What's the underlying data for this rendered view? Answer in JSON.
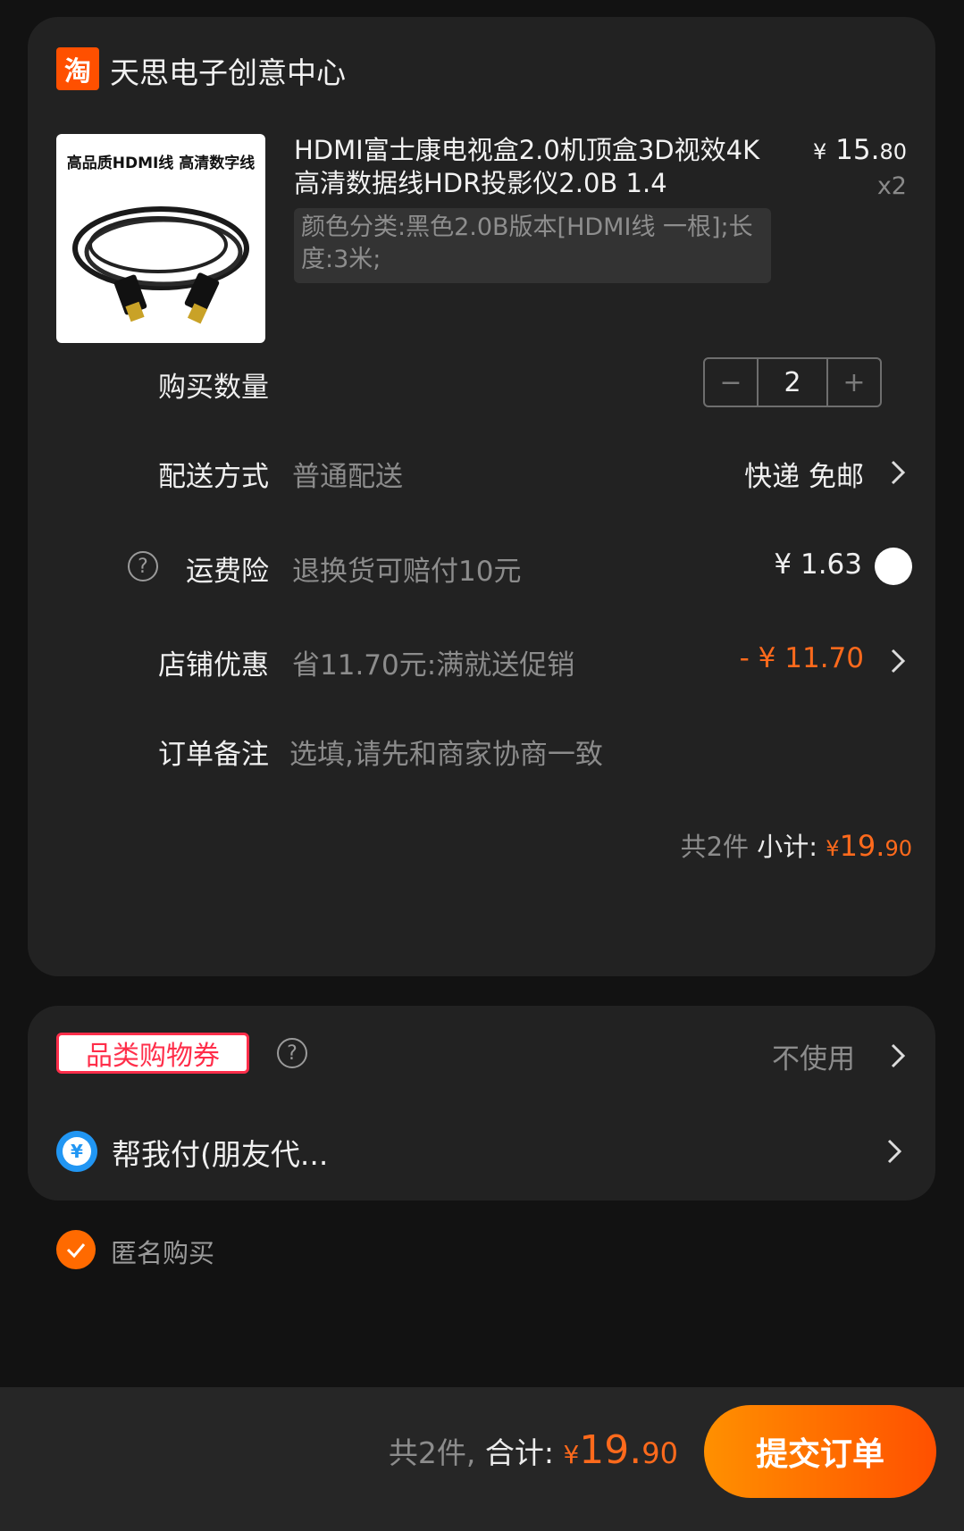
{
  "shop": {
    "logo_text": "淘",
    "name": "天思电子创意中心"
  },
  "product": {
    "thumb_text": "高品质HDMI线 高清数字线",
    "title": "HDMI富士康电视盒2.0机顶盒3D视效4K高清数据线HDR投影仪2.0B 1.4",
    "price_symbol": "¥",
    "price_int": "15.",
    "price_dec": "80",
    "qty_label": "x2",
    "sku": "颜色分类:黑色2.0B版本[HDMI线 一根];长度:3米;"
  },
  "quantity": {
    "label": "购买数量",
    "minus": "−",
    "value": "2",
    "plus": "+"
  },
  "shipping": {
    "label": "配送方式",
    "sub": "普通配送",
    "value": "快递 免邮"
  },
  "insurance": {
    "help": "?",
    "label": "运费险",
    "sub": "退换货可赔付10元",
    "value": "¥ 1.63",
    "selected": false
  },
  "discount": {
    "label": "店铺优惠",
    "sub": "省11.70元:满就送促销",
    "value": "- ¥ 11.70"
  },
  "note": {
    "label": "订单备注",
    "placeholder": "选填,请先和商家协商一致"
  },
  "subtotal": {
    "count_text": "共2件",
    "label": "小计:",
    "symbol": "¥",
    "int": "19.",
    "dec": "90"
  },
  "coupon": {
    "tag": "品类购物券",
    "help": "?",
    "value": "不使用"
  },
  "friend_pay": {
    "icon_text": "¥",
    "label": "帮我付(朋友代..."
  },
  "anonymous": {
    "label": "匿名购买",
    "checked": true
  },
  "footer": {
    "count_text": "共2件,",
    "total_label": "合计:",
    "symbol": "¥",
    "int": "19.",
    "dec": "90",
    "submit": "提交订单"
  },
  "colors": {
    "accent": "#ff6a1c",
    "brand": "#ff5000",
    "card": "#222222",
    "background": "#121212"
  }
}
